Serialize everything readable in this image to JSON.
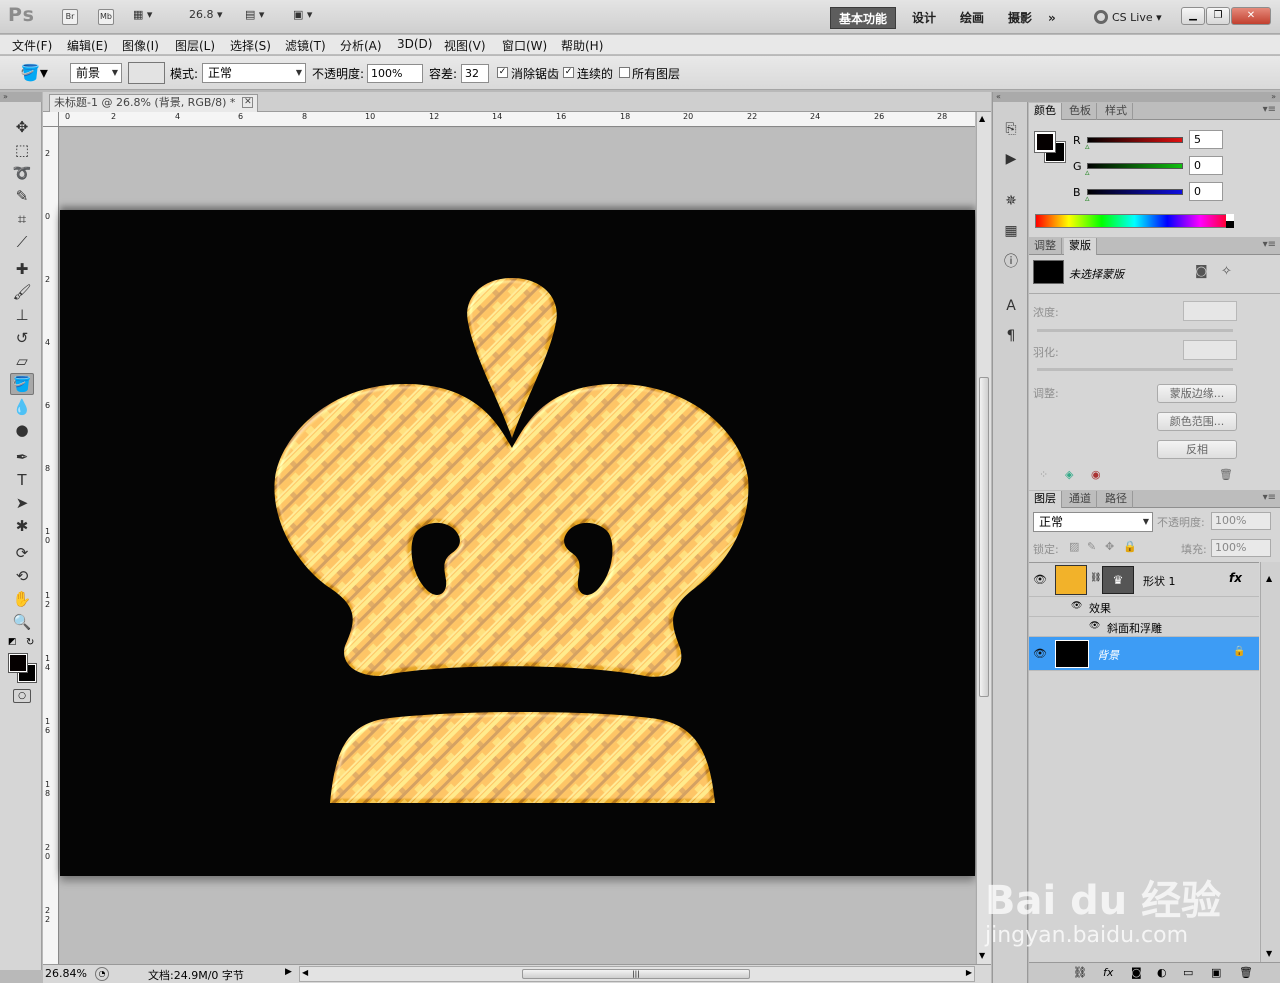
{
  "app": {
    "logo": "Ps",
    "chips": [
      "Br",
      "Mb"
    ],
    "zoom_dropdown": "26.8"
  },
  "workspaces": [
    "基本功能",
    "设计",
    "绘画",
    "摄影",
    "»"
  ],
  "cs_live": "CS Live",
  "menu": [
    "文件(F)",
    "编辑(E)",
    "图像(I)",
    "图层(L)",
    "选择(S)",
    "滤镜(T)",
    "分析(A)",
    "3D(D)",
    "视图(V)",
    "窗口(W)",
    "帮助(H)"
  ],
  "options": {
    "fill_source": "前景",
    "mode_label": "模式:",
    "mode_value": "正常",
    "opacity_label": "不透明度:",
    "opacity_value": "100%",
    "tolerance_label": "容差:",
    "tolerance_value": "32",
    "antialias": "消除锯齿",
    "contiguous": "连续的",
    "all_layers": "所有图层"
  },
  "document": {
    "tab_title": "未标题-1 @ 26.8% (背景, RGB/8) *",
    "h_ruler": [
      "0",
      "2",
      "4",
      "6",
      "8",
      "10",
      "12",
      "14",
      "16",
      "18",
      "20",
      "22",
      "24",
      "26",
      "28"
    ],
    "v_ruler": [
      "2",
      "0",
      "2",
      "4",
      "6",
      "8",
      "1 0",
      "1 2",
      "1 4",
      "1 6",
      "1 8",
      "2 0",
      "2 2"
    ]
  },
  "status": {
    "zoom": "26.84%",
    "doc_info": "文档:24.9M/0 字节"
  },
  "color_panel": {
    "tabs": [
      "颜色",
      "色板",
      "样式"
    ],
    "channels": [
      {
        "name": "R",
        "value": "5",
        "color": "#e01010"
      },
      {
        "name": "G",
        "value": "0",
        "color": "#10c010"
      },
      {
        "name": "B",
        "value": "0",
        "color": "#1010e0"
      }
    ]
  },
  "masks_panel": {
    "tabs": [
      "调整",
      "蒙版"
    ],
    "no_mask": "未选择蒙版",
    "density_label": "浓度:",
    "feather_label": "羽化:",
    "refine_label": "调整:",
    "buttons": [
      "蒙版边缘...",
      "颜色范围...",
      "反相"
    ]
  },
  "layers_panel": {
    "tabs": [
      "图层",
      "通道",
      "路径"
    ],
    "blend_mode": "正常",
    "opacity_label": "不透明度:",
    "opacity_value": "100%",
    "lock_label": "锁定:",
    "fill_label": "填充:",
    "fill_value": "100%",
    "layers": [
      {
        "name": "形状 1",
        "fx": "fx",
        "color": "#f2b22a"
      },
      {
        "name": "效果"
      },
      {
        "name": "斜面和浮雕"
      },
      {
        "name": "背景",
        "selected": true
      }
    ]
  },
  "watermark": {
    "brand": "Bai du 经验",
    "url": "jingyan.baidu.com"
  }
}
